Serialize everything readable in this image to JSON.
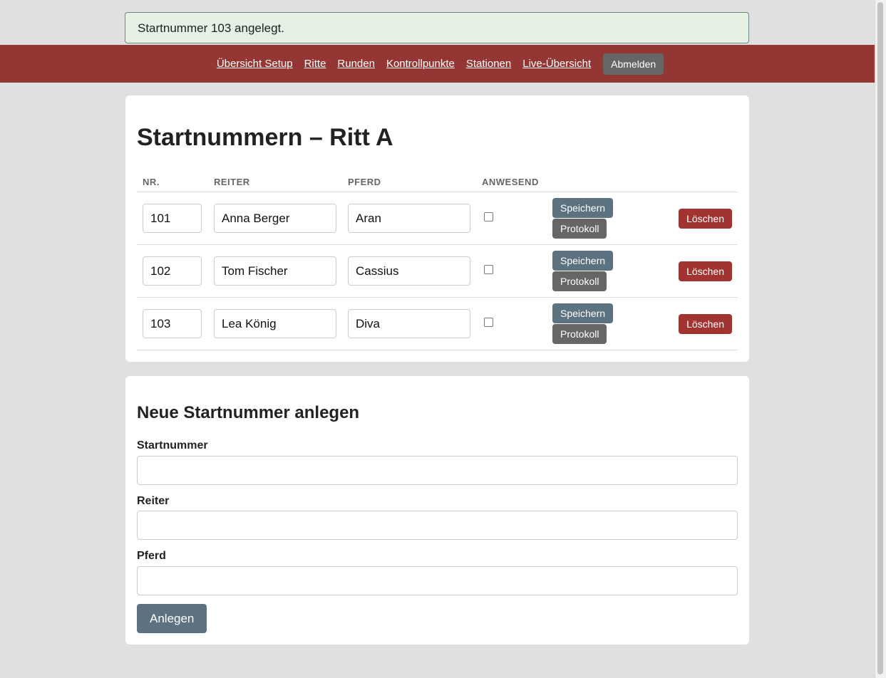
{
  "flash": {
    "message": "Startnummer 103 angelegt."
  },
  "nav": {
    "links": [
      "Übersicht Setup",
      "Ritte",
      "Runden",
      "Kontrollpunkte",
      "Stationen",
      "Live-Übersicht"
    ],
    "logout_label": "Abmelden"
  },
  "list": {
    "title": "Startnummern – Ritt A",
    "columns": [
      "NR.",
      "REITER",
      "PFERD",
      "ANWESEND"
    ],
    "rows": [
      {
        "nr": "101",
        "rider": "Anna Berger",
        "horse": "Aran",
        "present": false
      },
      {
        "nr": "102",
        "rider": "Tom Fischer",
        "horse": "Cassius",
        "present": false
      },
      {
        "nr": "103",
        "rider": "Lea König",
        "horse": "Diva",
        "present": false
      }
    ],
    "save_label": "Speichern",
    "protocol_label": "Protokoll",
    "delete_label": "Löschen"
  },
  "form": {
    "title": "Neue Startnummer anlegen",
    "startnummer_label": "Startnummer",
    "startnummer_value": "",
    "reiter_label": "Reiter",
    "reiter_value": "",
    "pferd_label": "Pferd",
    "pferd_value": "",
    "submit_label": "Anlegen"
  }
}
